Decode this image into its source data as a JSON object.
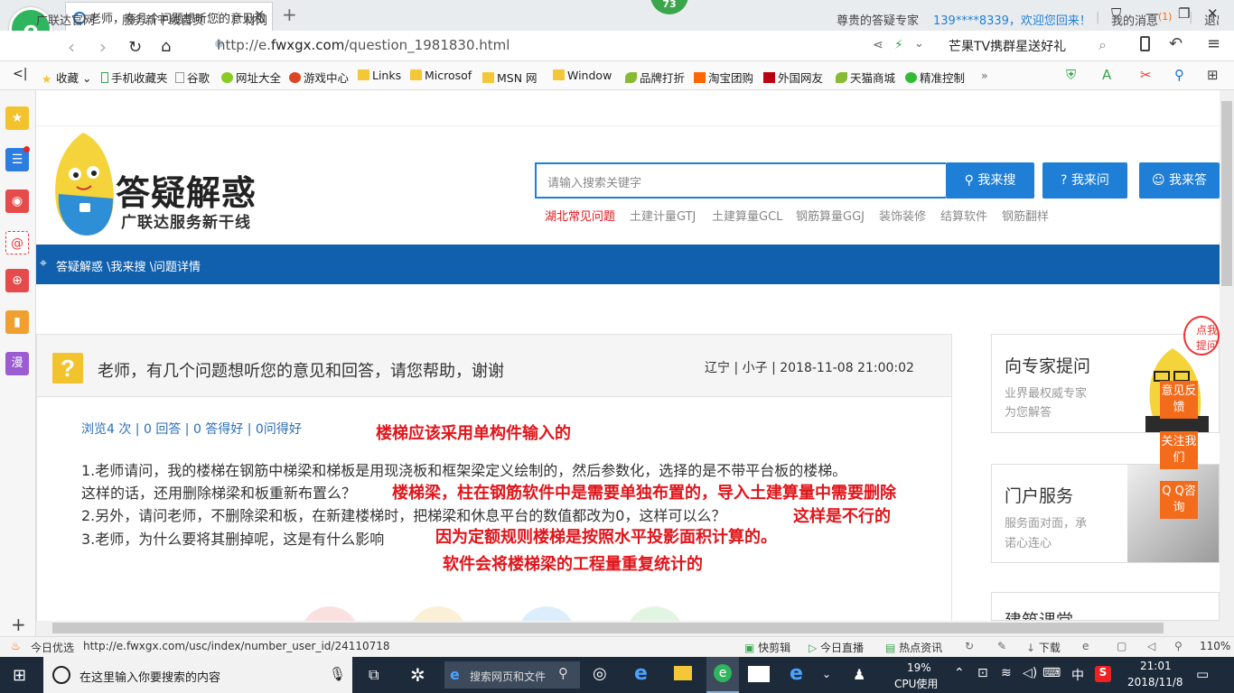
{
  "browser": {
    "logo_glyph": "e",
    "tab_title": "老师，有几个问题想听您的意见和",
    "badge_count": "73",
    "url_prefix": "http://e.",
    "url_domain": "fwxgx.com",
    "url_path": "/question_1981830.html",
    "search_hint": "芒果TV携群星送好礼",
    "bookmarks": [
      "收藏",
      "手机收藏夹",
      "谷歌",
      "网址大全",
      "游戏中心",
      "Links",
      "Microsof",
      "MSN 网",
      "Window",
      "品牌打折",
      "淘宝团购",
      "外国网友",
      "天猫商城",
      "精准控制"
    ]
  },
  "topnav": {
    "links": [
      "广联达官网",
      "服务新干线首页",
      "广材网"
    ],
    "expert": "尊贵的答疑专家",
    "welcome": "139****8339，欢迎您回来！",
    "messages": "我的消息",
    "msg_count": "(1)",
    "logout": "退出"
  },
  "brand": {
    "title": "答疑解惑",
    "subtitle": "广联达服务新干线"
  },
  "search": {
    "placeholder": "请输入搜索关键字",
    "btn_search": "我来搜",
    "btn_ask": "我来问",
    "btn_answer": "我来答",
    "hot": [
      "湖北常见问题",
      "土建计量GTJ",
      "土建算量GCL",
      "钢筋算量GGJ",
      "装饰装修",
      "结算软件",
      "钢筋翻样"
    ]
  },
  "breadcrumb": "答疑解惑 \\我来搜 \\问题详情",
  "question": {
    "title": "老师，有几个问题想听您的意见和回答，请您帮助，谢谢",
    "meta": "辽宁 | 小子 | 2018-11-08 21:00:02",
    "stats": "浏览4 次 | 0 回答 | 0 答得好 | 0问得好",
    "lines": [
      "1.老师请问，我的楼梯在钢筋中梯梁和梯板是用现浇板和框架梁定义绘制的，然后参数化，选择的是不带平台板的楼梯。",
      "这样的话，还用删除梯梁和板重新布置么？",
      "2.另外，请问老师，不删除梁和板，在新建楼梯时，把梯梁和休息平台的数值都改为0，这样可以么？",
      "3.老师，为什么要将其删掉呢，这是有什么影响"
    ],
    "annotations": [
      "楼梯应该采用单构件输入的",
      "楼梯梁，柱在钢筋软件中是需要单独布置的，导入土建算量中需要删除",
      "这样是不行的",
      "因为定额规则楼梯是按照水平投影面积计算的。",
      "软件会将楼梯梁的工程量重复统计的"
    ]
  },
  "right": {
    "card1_title": "向专家提问",
    "card1_l1": "业界最权威专家",
    "card1_l2": "为您解答",
    "card2_title": "门户服务",
    "card2_l1": "服务面对面，承",
    "card2_l2": "诺心连心",
    "card3_title": "建筑课堂",
    "bubble": "点我提问",
    "float_buttons": [
      "意见反馈",
      "关注我们",
      "Q Q咨询"
    ]
  },
  "statusbar": {
    "left": "今日优选",
    "hover_url": "http://e.fwxgx.com/usc/index/number_user_id/24110718",
    "items": [
      "快剪辑",
      "今日直播",
      "热点资讯",
      "下载"
    ],
    "zoom": "110%"
  },
  "taskbar": {
    "search_placeholder": "在这里输入你要搜索的内容",
    "browser_search": "搜索网页和文件",
    "cpu_pct": "19%",
    "cpu_label": "CPU使用",
    "ime": "中",
    "time": "21:01",
    "date": "2018/11/8"
  }
}
